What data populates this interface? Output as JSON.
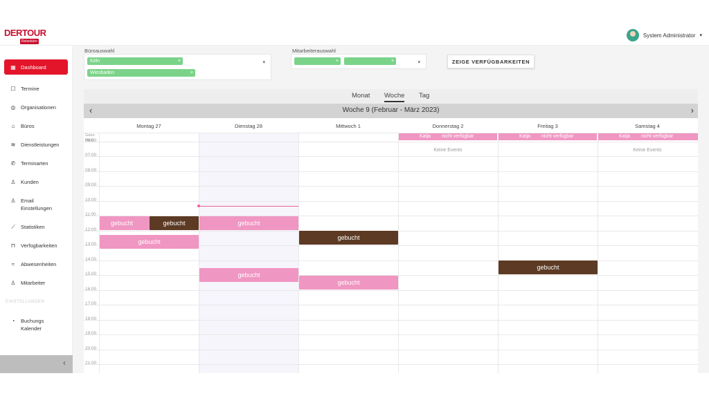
{
  "header": {
    "logo_brand": "DERTOUR",
    "logo_sub": "Reisebüro",
    "user_name": "System Administrator",
    "caret": "▾"
  },
  "sidebar": {
    "items": [
      {
        "label": "Dashboard",
        "icon": "grid-icon",
        "glyph": "▦"
      },
      {
        "label": "Termine",
        "icon": "calendar-icon",
        "glyph": "☐"
      },
      {
        "label": "Organisationen",
        "icon": "globe-icon",
        "glyph": "◎"
      },
      {
        "label": "Büros",
        "icon": "home-icon",
        "glyph": "⌂"
      },
      {
        "label": "Dienstleistungen",
        "icon": "layers-icon",
        "glyph": "≋"
      },
      {
        "label": "Terminarten",
        "icon": "phone-icon",
        "glyph": "✆"
      },
      {
        "label": "Kunden",
        "icon": "users-icon",
        "glyph": "♙"
      },
      {
        "label": "Email Einstellungen",
        "icon": "user-icon",
        "glyph": "♙"
      },
      {
        "label": "Statistiken",
        "icon": "chart-icon",
        "glyph": "⟋"
      },
      {
        "label": "Verfügbarkeiten",
        "icon": "bag-icon",
        "glyph": "⊓"
      },
      {
        "label": "Abwesenheiten",
        "icon": "wifi-icon",
        "glyph": "≈"
      },
      {
        "label": "Mitarbeiter",
        "icon": "person-icon",
        "glyph": "♙"
      },
      {
        "label": "Buchungs Kalender",
        "icon": "compass-icon",
        "glyph": "◔"
      }
    ],
    "section": "EINSTELLUNGEN",
    "collapse_glyph": "‹"
  },
  "filters": {
    "office_label": "Büroauswahl",
    "offices": [
      "Köln",
      "Wiesbaden"
    ],
    "employee_label": "Mitarbeiterauswahl",
    "employees": [
      "",
      ""
    ],
    "remove_glyph": "×",
    "dropdown_glyph": "▾",
    "show_button": "ZEIGE VERFÜGBARKEITEN"
  },
  "calendar": {
    "tabs": [
      "Monat",
      "Woche",
      "Tag"
    ],
    "active_tab": "Woche",
    "week_title": "Woche 9 (Februar - März 2023)",
    "prev": "‹",
    "next": "›",
    "days": [
      "Montag 27",
      "Dienstag 28",
      "Mittwoch 1",
      "Donnerstag 2",
      "Freitag 3",
      "Samstag 4"
    ],
    "allday_label": "Ganz-tägig",
    "allday_events": [
      {
        "day": "Donnerstag 2",
        "name": "Katja",
        "status": "nicht verfügbar"
      },
      {
        "day": "Freitag 3",
        "name": "Katja",
        "status": "nicht verfügbar"
      },
      {
        "day": "Samstag 4",
        "name": "Katja",
        "status": "nicht verfügbar"
      }
    ],
    "no_events": "Keine Events",
    "times": [
      "06:00",
      "07:00",
      "08:00",
      "09:00",
      "10:00",
      "11:00",
      "12:00",
      "13:00",
      "14:00",
      "15:00",
      "16:00",
      "17:00",
      "18:00",
      "19:00",
      "20:00",
      "21:00"
    ],
    "events": [
      {
        "label": "gebucht",
        "day": "Montag 27",
        "start": "11:00",
        "end": "12:00",
        "color": "#f096c2"
      },
      {
        "label": "gebucht",
        "day": "Montag 27",
        "start": "11:00",
        "end": "12:00",
        "color": "#5d3a24"
      },
      {
        "label": "gebucht",
        "day": "Montag 27",
        "start": "12:00",
        "end": "13:00",
        "color": "#f096c2"
      },
      {
        "label": "gebucht",
        "day": "Dienstag 28",
        "start": "11:00",
        "end": "12:00",
        "color": "#f096c2"
      },
      {
        "label": "gebucht",
        "day": "Dienstag 28",
        "start": "14:30",
        "end": "15:30",
        "color": "#f096c2"
      },
      {
        "label": "gebucht",
        "day": "Mittwoch 1",
        "start": "12:00",
        "end": "13:00",
        "color": "#5d3a24"
      },
      {
        "label": "gebucht",
        "day": "Mittwoch 1",
        "start": "15:00",
        "end": "16:00",
        "color": "#f096c2"
      },
      {
        "label": "gebucht",
        "day": "Freitag 3",
        "start": "14:00",
        "end": "15:00",
        "color": "#5d3a24"
      }
    ]
  }
}
